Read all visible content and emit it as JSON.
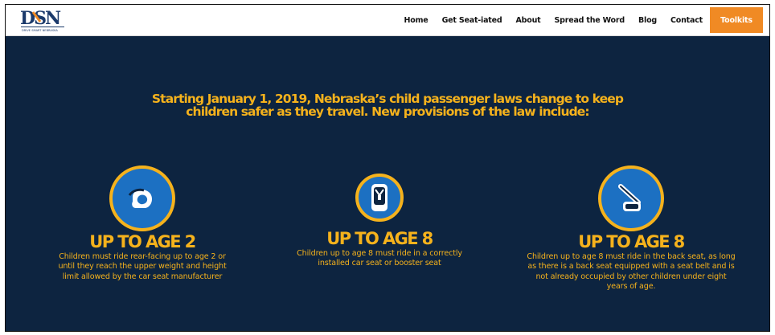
{
  "brand": {
    "logo_text": "DSN",
    "logo_tagline": "DRIVE SMART NEBRASKA"
  },
  "nav": {
    "items": [
      "Home",
      "Get Seat-iated",
      "About",
      "Spread the Word",
      "Blog",
      "Contact"
    ],
    "cta_label": "Toolkits"
  },
  "hero": {
    "line1": "Starting January 1, 2019, Nebraska’s child passenger laws change to keep",
    "line2": "children safer as they travel. New provisions of the law include:"
  },
  "provisions": [
    {
      "icon": "rear-facing-seat-icon",
      "heading": "UP TO AGE 2",
      "line1": "Children must ride rear-facing up to age 2 or",
      "line2": "until they reach the upper weight and height",
      "line3": "limit allowed by the car seat manufacturer",
      "line4": ""
    },
    {
      "icon": "car-seat-harness-icon",
      "heading": "UP TO AGE 8",
      "line1": "Children up to age 8 must ride in a correctly",
      "line2": "installed car seat or booster seat",
      "line3": "",
      "line4": ""
    },
    {
      "icon": "back-seat-belt-icon",
      "heading": "UP TO AGE 8",
      "line1": "Children up to age 8 must ride in the back seat, as long",
      "line2": "as there is a back seat equipped with a seat belt and is",
      "line3": "not already occupied by other children under eight",
      "line4": "years of age."
    }
  ],
  "colors": {
    "background": "#0d2440",
    "accent": "#f5b21c",
    "badge": "#1c70c2",
    "cta": "#f08a24"
  }
}
